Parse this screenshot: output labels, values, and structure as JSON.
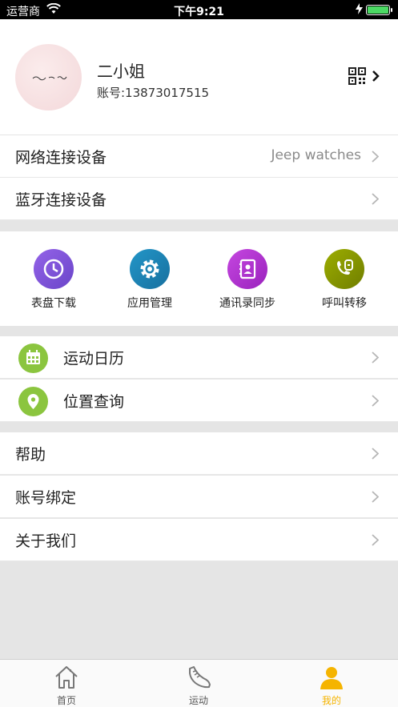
{
  "status_bar": {
    "carrier": "运营商",
    "time": "下午9:21"
  },
  "profile": {
    "name": "二小姐",
    "account": "账号:13873017515"
  },
  "menu1": [
    {
      "label": "网络连接设备",
      "value": "Jeep watches"
    },
    {
      "label": "蓝牙连接设备"
    }
  ],
  "functions": [
    {
      "label": "表盘下载",
      "icon": "clock-icon",
      "color": "#7d56d6"
    },
    {
      "label": "应用管理",
      "icon": "gear-icon",
      "color": "#1e82b4"
    },
    {
      "label": "通讯录同步",
      "icon": "contacts-icon",
      "color": "#b334d0"
    },
    {
      "label": "呼叫转移",
      "icon": "call-forward-icon",
      "color": "#8a9a00"
    }
  ],
  "menu2": [
    {
      "label": "运动日历",
      "icon": "calendar-icon"
    },
    {
      "label": "位置查询",
      "icon": "location-icon"
    }
  ],
  "menu3": [
    {
      "label": "帮助"
    },
    {
      "label": "账号绑定"
    },
    {
      "label": "关于我们"
    }
  ],
  "tabs": [
    {
      "label": "首页",
      "icon": "home-icon"
    },
    {
      "label": "运动",
      "icon": "shoe-icon"
    },
    {
      "label": "我的",
      "icon": "person-icon"
    }
  ],
  "colors": {
    "accent": "#f5b400",
    "green": "#8bc53f"
  }
}
